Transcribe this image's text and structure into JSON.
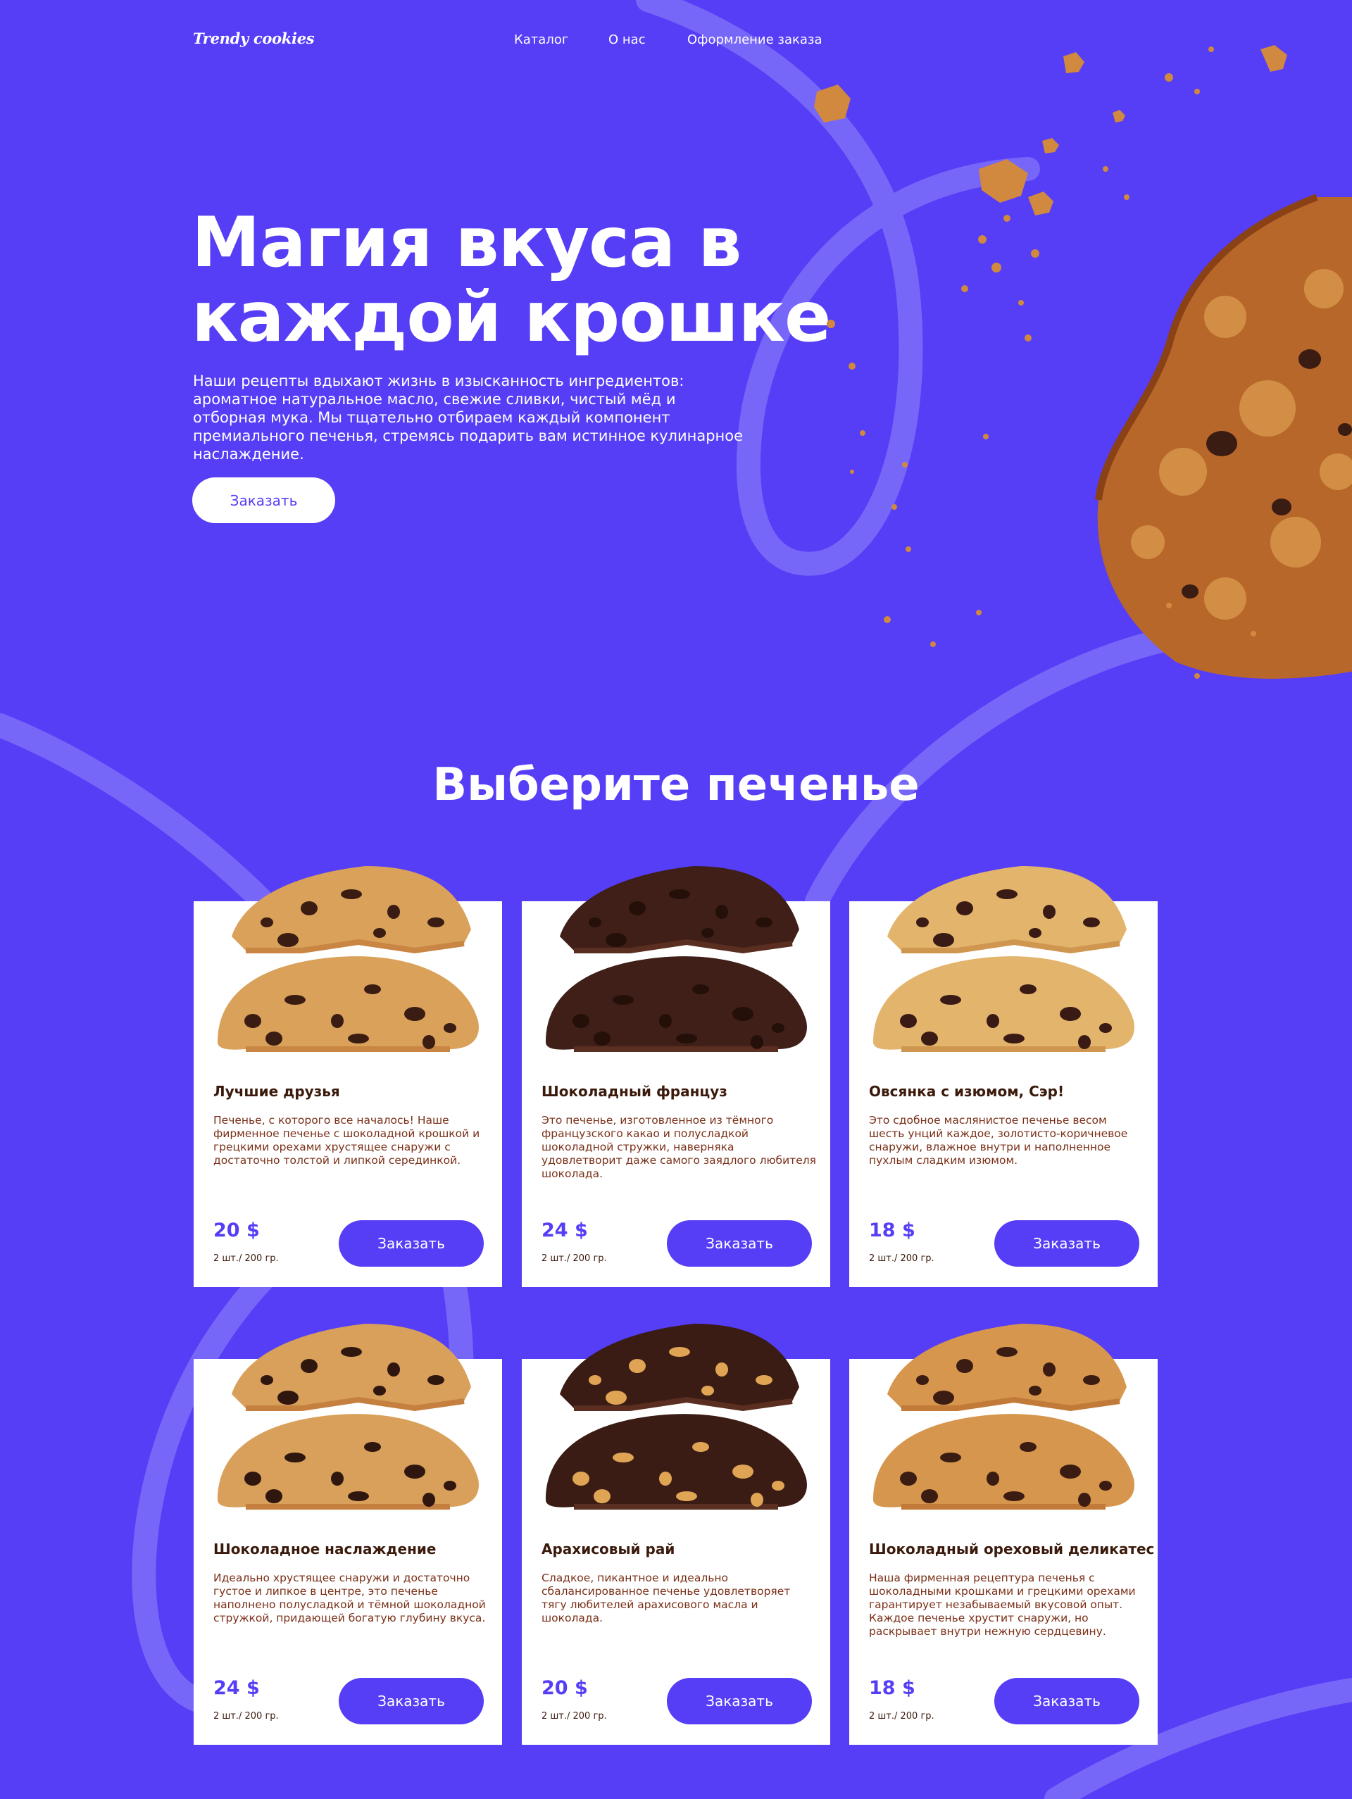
{
  "header": {
    "logo": "Trendy cookies",
    "nav": [
      "Каталог",
      "О нас",
      "Оформление заказа"
    ]
  },
  "hero": {
    "title_line1": "Магия вкуса в",
    "title_line2": "каждой крошке",
    "text": "Наши рецепты вдыхают жизнь в изысканность ингредиентов: ароматное натуральное масло, свежие сливки, чистый мёд и отборная мука. Мы тщательно отбираем каждый компонент премиального печенья, стремясь подарить вам истинное кулинарное наслаждение.",
    "button": "Заказать"
  },
  "catalog": {
    "title": "Выберите печенье",
    "cards": [
      {
        "name": "Лучшие друзья",
        "desc": "Печенье, с которого все началось! Наше фирменное печенье с шоколадной крошкой и грецкими орехами хрустящее снаружи с достаточно толстой и липкой серединкой.",
        "price": "20 $",
        "qty": "2 шт./ 200 гр.",
        "button": "Заказать",
        "image": "cookie-chocolate-chip-walnut"
      },
      {
        "name": "Шоколадный француз",
        "desc": "Это печенье, изготовленное из тёмного французского какао и полусладкой шоколадной стружки, наверняка удовлетворит даже самого заядлого любителя шоколада.",
        "price": "24 $",
        "qty": "2 шт./ 200 гр.",
        "button": "Заказать",
        "image": "cookie-dark-chocolate"
      },
      {
        "name": "Овсянка с изюмом, Сэр!",
        "desc": "Это сдобное маслянистое печенье весом шесть унций каждое, золотисто-коричневое снаружи, влажное внутри и наполненное пухлым сладким изюмом.",
        "price": "18 $",
        "qty": "2 шт./ 200 гр.",
        "button": "Заказать",
        "image": "cookie-oatmeal-raisin"
      },
      {
        "name": "Шоколадное наслаждение",
        "desc": "Идеально хрустящее снаружи и достаточно густое и липкое в центре, это печенье наполнено полусладкой и тёмной шоколадной стружкой, придающей богатую глубину вкуса.",
        "price": "24 $",
        "qty": "2 шт./ 200 гр.",
        "button": "Заказать",
        "image": "cookie-chocolate-chunk"
      },
      {
        "name": "Арахисовый рай",
        "desc": "Сладкое, пикантное и идеально сбалансированное печенье удовлетворяет тягу любителей арахисового масла и шоколада.",
        "price": "20 $",
        "qty": "2 шт./ 200 гр.",
        "button": "Заказать",
        "image": "cookie-peanut-butter-chip"
      },
      {
        "name": "Шоколадный ореховый деликатес",
        "desc": "Наша фирменная рецептура печенья с шоколадными крошками и грецкими орехами гарантирует незабываемый вкусовой опыт. Каждое печенье хрустит снаружи, но раскрывает внутри нежную сердцевину.",
        "price": "18 $",
        "qty": "2 шт./ 200 гр.",
        "button": "Заказать",
        "image": "cookie-chocolate-walnut"
      }
    ]
  },
  "colors": {
    "background": "#553ef6",
    "swirl": "#7a68f8",
    "card_title": "#3b1a0c",
    "card_text": "#7a2f17",
    "cookie_light": "#d9a15a",
    "cookie_dark": "#3a1c12"
  }
}
